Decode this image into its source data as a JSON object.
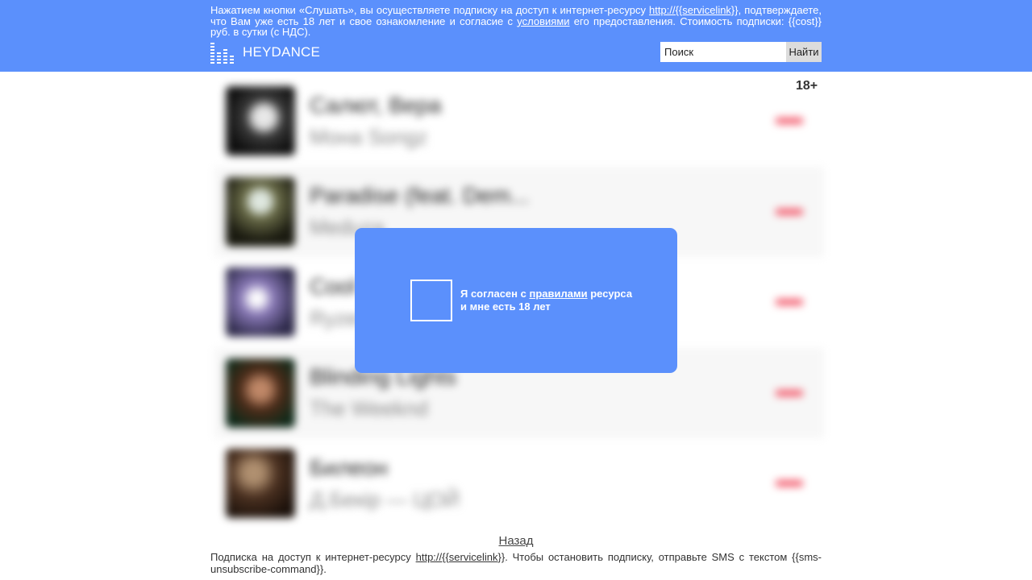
{
  "header": {
    "disclaimer_part1": "Нажатием кнопки «Слушать», вы осуществляете подписку на доступ к интернет-ресурсу ",
    "service_link": "http://{{servicelink}}",
    "disclaimer_part2": ", подтверждаете, что Вам уже есть 18 лет и свое ознакомление и согласие с ",
    "terms_link": "условиями",
    "disclaimer_part3": " его предоставления. Стоимость подписки: {{cost}} руб. в сутки (с НДС).",
    "logo_text": "HEYDANCE",
    "logo_icon": "equalizer-icon",
    "background_color": "#5b90fc"
  },
  "search": {
    "placeholder": "Поиск",
    "button_label": "Найти"
  },
  "age_badge": "18+",
  "modal": {
    "consent_part1": "Я согласен с ",
    "rules_link": "правилами",
    "consent_part2": " ресурса",
    "consent_line2": "и мне есть 18 лет"
  },
  "tracks": [
    {
      "title": "Салют, Вера",
      "artist": "Мона Songz"
    },
    {
      "title": "Paradise (feat. Dem...",
      "artist": "Meduza"
    },
    {
      "title": "Cool",
      "artist": "Ryzen"
    },
    {
      "title": "Blinding Lights",
      "artist": "The Weeknd"
    },
    {
      "title": "Билеон",
      "artist": "Д.Бекiр — ЦОЙ"
    }
  ],
  "footer": {
    "back_label": "Назад",
    "note_part1": "Подписка на доступ к интернет-ресурсу ",
    "service_link": "http://{{servicelink}}",
    "note_part2": ". Чтобы остановить подписку, отправьте SMS с текстом {{sms-unsubscribe-command}}."
  }
}
